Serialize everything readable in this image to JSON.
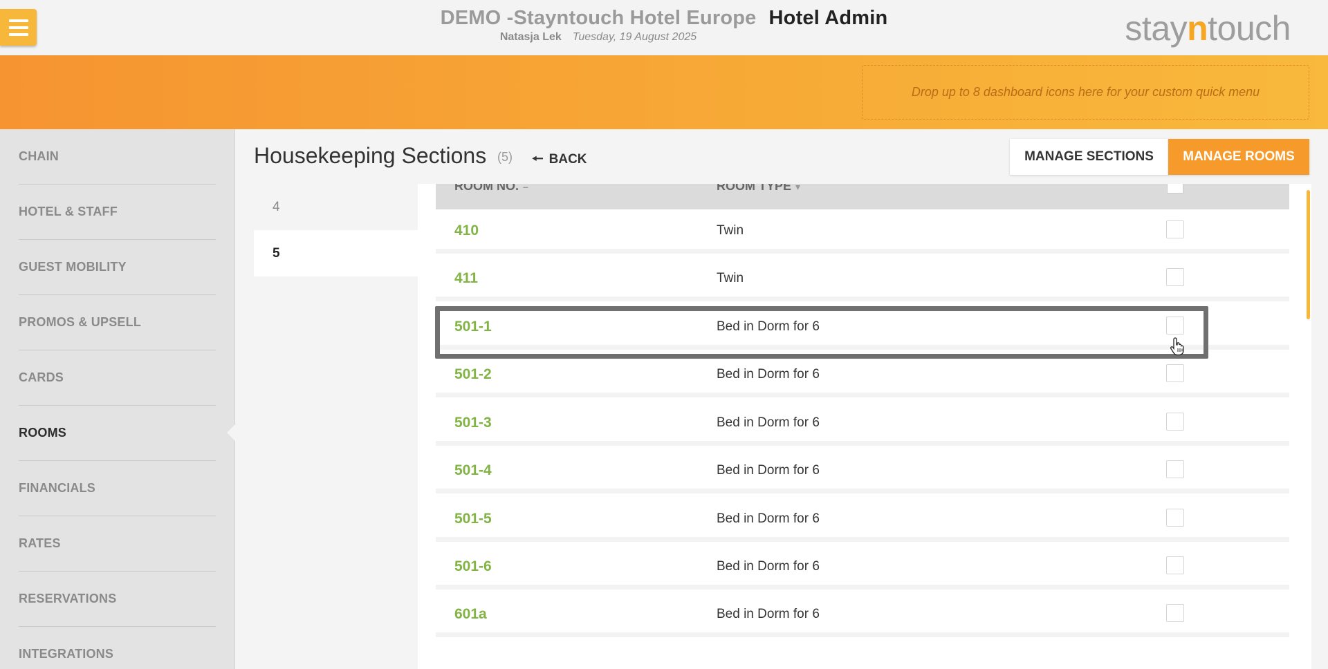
{
  "header": {
    "hotel_name": "DEMO -Stayntouch Hotel Europe",
    "app_title": "Hotel Admin",
    "user": "Natasja Lek",
    "date": "Tuesday, 19 August 2025",
    "logo_text_pre": "stay",
    "logo_text_n": "n",
    "logo_text_post": "touch"
  },
  "band": {
    "dropzone_text": "Drop up to 8 dashboard icons here for your custom quick menu"
  },
  "sidebar": {
    "items": [
      {
        "label": "CHAIN"
      },
      {
        "label": "HOTEL & STAFF"
      },
      {
        "label": "GUEST MOBILITY"
      },
      {
        "label": "PROMOS & UPSELL"
      },
      {
        "label": "CARDS"
      },
      {
        "label": "ROOMS",
        "active": true
      },
      {
        "label": "FINANCIALS"
      },
      {
        "label": "RATES"
      },
      {
        "label": "RESERVATIONS"
      },
      {
        "label": "INTEGRATIONS"
      }
    ]
  },
  "main": {
    "title": "Housekeeping Sections",
    "count": "(5)",
    "back_label": "BACK",
    "manage_sections_label": "MANAGE SECTIONS",
    "manage_rooms_label": "MANAGE ROOMS"
  },
  "sections": [
    {
      "label": "4"
    },
    {
      "label": "5",
      "active": true
    }
  ],
  "table": {
    "col_room_no": "ROOM NO.",
    "col_room_type": "ROOM TYPE",
    "rows": [
      {
        "room": "410",
        "type": "Twin"
      },
      {
        "room": "411",
        "type": "Twin"
      },
      {
        "room": "501-1",
        "type": "Bed in Dorm for 6"
      },
      {
        "room": "501-2",
        "type": "Bed in Dorm for 6"
      },
      {
        "room": "501-3",
        "type": "Bed in Dorm for 6"
      },
      {
        "room": "501-4",
        "type": "Bed in Dorm for 6"
      },
      {
        "room": "501-5",
        "type": "Bed in Dorm for 6"
      },
      {
        "room": "501-6",
        "type": "Bed in Dorm for 6"
      },
      {
        "room": "601a",
        "type": "Bed in Dorm for 6"
      }
    ]
  },
  "colors": {
    "accent_orange": "#f69a2b",
    "room_green": "#82b445",
    "menu_yellow": "#f6b73a"
  }
}
